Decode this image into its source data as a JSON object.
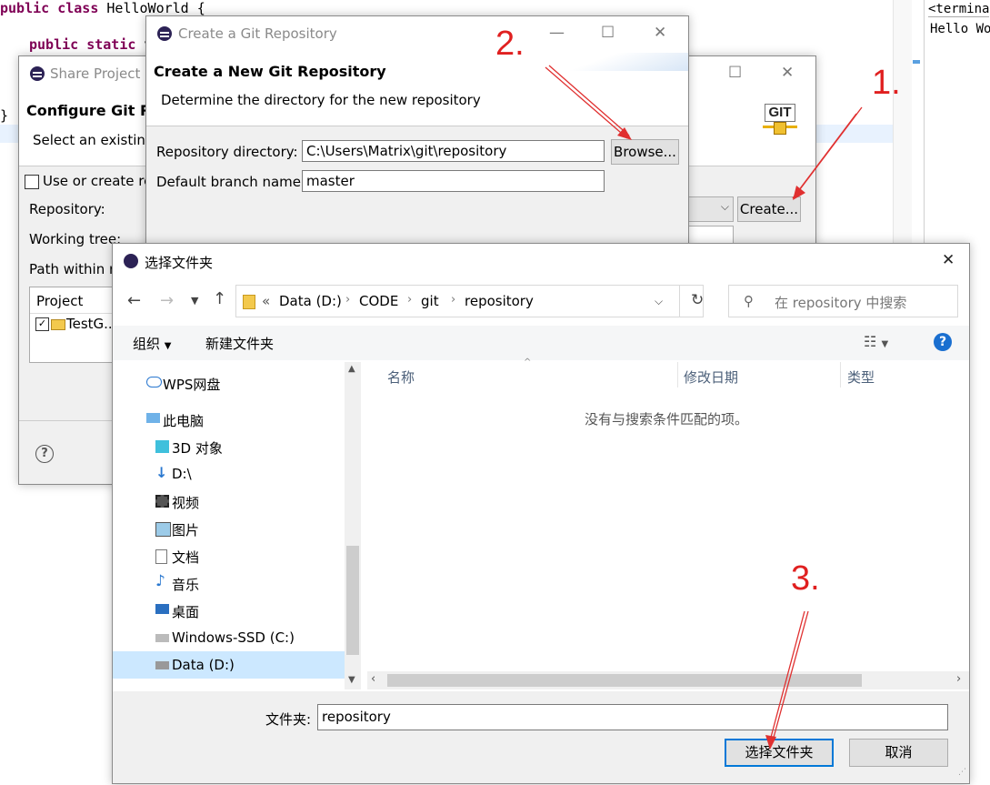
{
  "editor": {
    "line1": "public class HelloWorld {",
    "line2_kw1": "public",
    "line2_kw2": "static",
    "line2_rest": " v",
    "brace": "}",
    "console_tab": "<termina",
    "console_text": "Hello Wo"
  },
  "share": {
    "title": "Share Project",
    "heading": "Configure Git Re",
    "subtitle": "Select an existing",
    "checkbox_label": "Use or create re",
    "repository_label": "Repository:",
    "working_tree_label": "Working tree:",
    "path_label": "Path within re",
    "project_col": "Project",
    "project_item": "TestG...",
    "create_button": "Create...",
    "help_icon": "?"
  },
  "create_repo": {
    "title": "Create a Git Repository",
    "heading": "Create a New Git Repository",
    "description": "Determine the directory for the new repository",
    "dir_label": "Repository directory:",
    "dir_value": "C:\\Users\\Matrix\\git\\repository",
    "browse_button": "Browse...",
    "branch_label": "Default branch name:",
    "branch_value": "master",
    "git_logo_text": "GIT"
  },
  "folder_dialog": {
    "title": "选择文件夹",
    "breadcrumb": [
      "Data (D:)",
      "CODE",
      "git",
      "repository"
    ],
    "breadcrumb_prefix": "«",
    "search_placeholder": "在 repository 中搜索",
    "organize": "组织",
    "new_folder": "新建文件夹",
    "nav": [
      "WPS网盘",
      "此电脑",
      "3D 对象",
      "D:\\",
      "视频",
      "图片",
      "文档",
      "音乐",
      "桌面",
      "Windows-SSD (C:)",
      "Data (D:)"
    ],
    "columns": [
      "名称",
      "修改日期",
      "类型"
    ],
    "empty_message": "没有与搜索条件匹配的项。",
    "folder_label": "文件夹:",
    "folder_value": "repository",
    "select_button": "选择文件夹",
    "cancel_button": "取消"
  },
  "annotations": [
    "1.",
    "2.",
    "3."
  ],
  "colors": {
    "annotation": "#e02020",
    "selected_nav": "#cce8ff",
    "help_blue": "#1a6fd0"
  }
}
